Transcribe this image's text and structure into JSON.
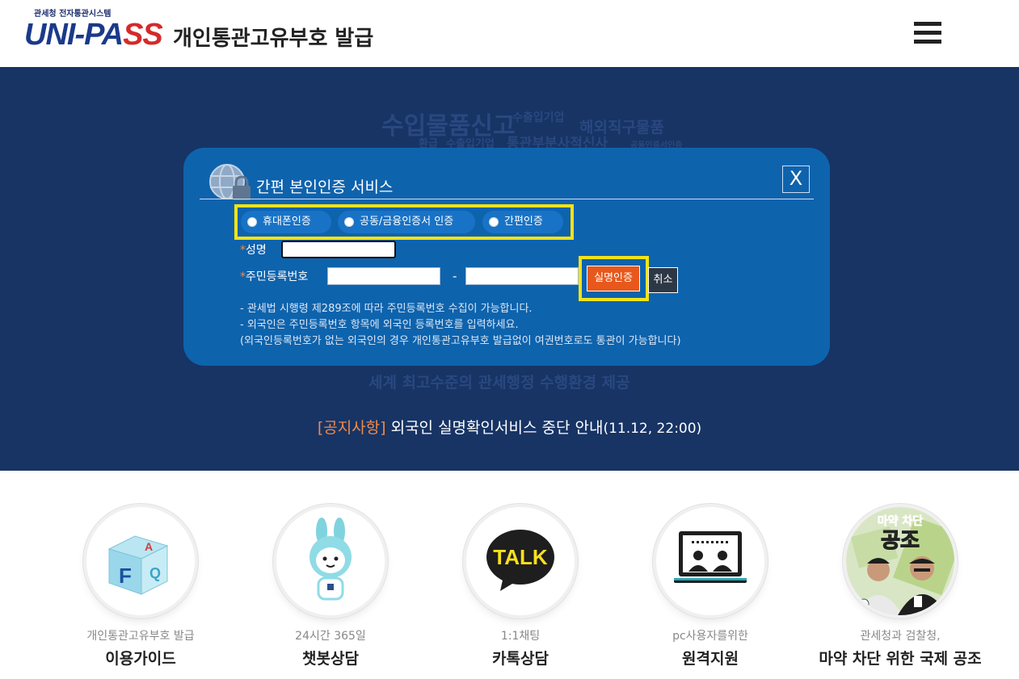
{
  "header": {
    "logo_small": "관세청 전자통관시스템",
    "logo_main_blue": "UNI-PA",
    "logo_main_red": "SS",
    "title": "개인통관고유부호 발급",
    "menu_icon": "hamburger-icon"
  },
  "hero": {
    "bg_words": [
      "수입물품신고",
      "수출입기업",
      "해외직구물품",
      "환급",
      "수출입기업",
      "통관부분사적신사",
      "공동인증서인증",
      "세계 최고수준의 관세행정 수행환경 제공"
    ],
    "notice_tag": "[공지사항]",
    "notice_text": " 외국인 실명확인서비스 중단 안내",
    "notice_date": "(11.12, 22:00)"
  },
  "modal": {
    "title": "간편 본인인증 서비스",
    "close_label": "X",
    "radios": [
      "휴대폰인증",
      "공동/금융인증서 인증",
      "간편인증"
    ],
    "name_label": "성명",
    "rrn_label": "주민등록번호",
    "star": "*",
    "dash": "-",
    "verify_button": "실명인증",
    "cancel_button": "취소",
    "notes": [
      "- 관세법 시행령 제289조에 따라 주민등록번호 수집이 가능합니다.",
      "- 외국인은 주민등록번호 항목에 외국인 등록번호를 입력하세요.",
      "(외국인등록번호가 없는 외국인의 경우 개인통관고유부호 발급없이 여권번호로도 통관이 가능합니다)"
    ]
  },
  "services": [
    {
      "sub": "개인통관고유부호 발급",
      "main": "이용가이드",
      "icon": "faq-cube-icon"
    },
    {
      "sub": "24시간 365일",
      "main": "챗봇상담",
      "icon": "chatbot-rabbit-icon"
    },
    {
      "sub": "1:1채팅",
      "main": "카톡상담",
      "icon": "kakao-talk-icon"
    },
    {
      "sub": "pc사용자를위한",
      "main": "원격지원",
      "icon": "remote-support-icon"
    },
    {
      "sub": "관세청과 검찰청,",
      "main": "마약 차단 위한 국제 공조",
      "icon": "drug-cooperation-photo",
      "badge_top": "마약 차단",
      "badge_big": "공조"
    }
  ],
  "colors": {
    "hero_bg": "#173465",
    "modal_bg": "#0e63ad",
    "highlight": "#f3e316",
    "verify": "#e8581c"
  }
}
